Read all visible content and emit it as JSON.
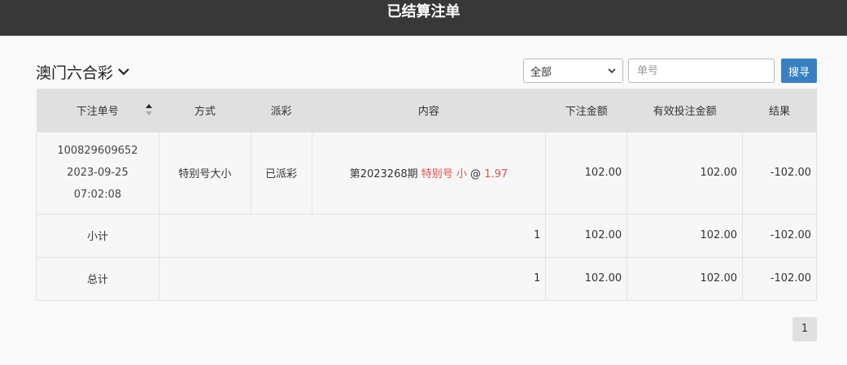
{
  "header": {
    "title": "已结算注单"
  },
  "filter": {
    "lottery_name": "澳门六合彩",
    "type_selected": "全部",
    "search_placeholder": "单号",
    "search_button": "搜寻"
  },
  "table": {
    "columns": [
      "下注单号",
      "方式",
      "派彩",
      "内容",
      "下注金额",
      "有效投注金额",
      "结果"
    ],
    "rows": [
      {
        "order_no": "100829609652",
        "date": "2023-09-25",
        "time": "07:02:08",
        "method": "特别号大小",
        "payout_status": "已派彩",
        "content_period": "第2023268期",
        "content_play": "特别号 小",
        "content_at": "@",
        "content_odds": "1.97",
        "bet_amount": "102.00",
        "valid_amount": "102.00",
        "result": "-102.00"
      }
    ],
    "subtotal": {
      "label": "小计",
      "count": "1",
      "bet_amount": "102.00",
      "valid_amount": "102.00",
      "result": "-102.00"
    },
    "total": {
      "label": "总计",
      "count": "1",
      "bet_amount": "102.00",
      "valid_amount": "102.00",
      "result": "-102.00"
    }
  },
  "pagination": {
    "current_page": "1"
  },
  "colors": {
    "header_bg": "#383838",
    "accent_blue": "#3a7fc1",
    "negative_red": "#d9534f"
  }
}
